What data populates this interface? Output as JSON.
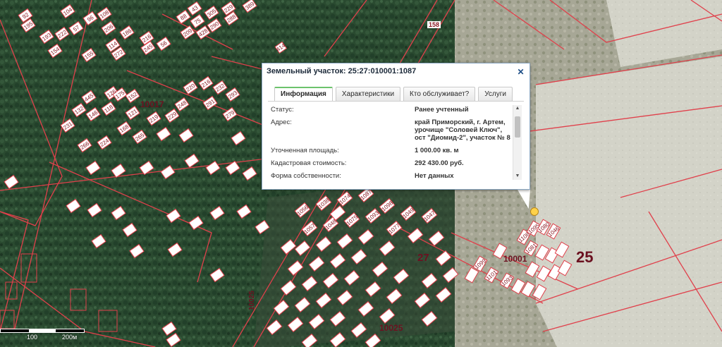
{
  "popup": {
    "title": "Земельный участок: 25:27:010001:1087",
    "close_icon": "close-icon",
    "tabs": [
      "Информация",
      "Характеристики",
      "Кто обслуживает?",
      "Услуги"
    ],
    "active_tab": "Информация",
    "rows": [
      {
        "key": "Статус:",
        "value": "Ранее учтенный"
      },
      {
        "key": "Адрес:",
        "value": "край Приморский, г. Артем, урочище \"Соловей Ключ\", ост \"Диомид-2\", участок № 8"
      },
      {
        "key": "Уточненная площадь:",
        "value": "1 000.00 кв. м"
      },
      {
        "key": "Кадастровая стоимость:",
        "value": "292 430.00 руб."
      },
      {
        "key": "Форма собственности:",
        "value": "Нет данных"
      }
    ]
  },
  "map": {
    "quarter_labels": [
      "10017",
      "27",
      "10001",
      "25",
      "10025",
      "10025"
    ],
    "road_labels": [
      "158",
      "10025"
    ],
    "plot_labels_left": [
      "92",
      "104",
      "195",
      "193",
      "222",
      "57",
      "96",
      "108",
      "206",
      "154",
      "155",
      "114",
      "186",
      "272",
      "216",
      "245",
      "56",
      "88",
      "43",
      "75",
      "305",
      "290",
      "229",
      "288",
      "209",
      "428",
      "389",
      "414",
      "445",
      "126",
      "175",
      "152",
      "132",
      "146",
      "118",
      "121",
      "219",
      "229",
      "248",
      "220",
      "216",
      "232",
      "293",
      "291",
      "279",
      "231",
      "266",
      "224",
      "168",
      "265"
    ],
    "plot_labels_center": [
      "1056",
      "1038",
      "1074",
      "1087",
      "1098",
      "1049",
      "1047",
      "1057",
      "1048",
      "1075",
      "1093",
      "1077",
      "1099",
      "1101",
      "1093",
      "1108",
      "1095",
      "1080",
      "1046",
      "1081"
    ],
    "scale_labels": [
      "100",
      "200м"
    ]
  },
  "colors": {
    "parcel_outline": "#e0404b",
    "label_fill": "#ffffff",
    "label_text": "#8a1a24",
    "quarter_text": "#6b1120",
    "popup_accent": "#6cc36c",
    "forest": "#2b4b31",
    "field": "#cfcfc3",
    "marker": "#ffd24a"
  }
}
